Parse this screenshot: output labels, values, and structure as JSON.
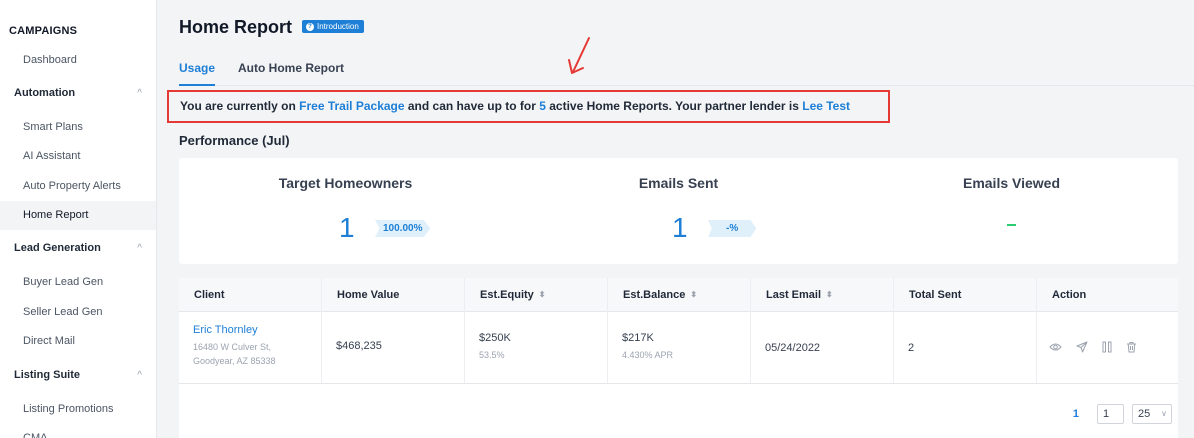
{
  "sidebar": {
    "title": "CAMPAIGNS",
    "dashboard": "Dashboard",
    "automation": "Automation",
    "smart_plans": "Smart Plans",
    "ai_assistant": "AI Assistant",
    "auto_property_alerts": "Auto Property Alerts",
    "home_report": "Home Report",
    "lead_generation": "Lead Generation",
    "buyer_lead_gen": "Buyer Lead Gen",
    "seller_lead_gen": "Seller Lead Gen",
    "direct_mail": "Direct Mail",
    "listing_suite": "Listing Suite",
    "listing_promotions": "Listing Promotions",
    "cma": "CMA",
    "chevron": "^"
  },
  "header": {
    "title": "Home Report",
    "badge": "Introduction",
    "badge_icon": "?"
  },
  "tabs": {
    "usage": "Usage",
    "auto": "Auto Home Report"
  },
  "notice": {
    "part1": "You are currently on ",
    "package": "Free Trail Package",
    "part2": " and can have up to for ",
    "count": "5",
    "part3": " active Home Reports. Your partner lender is ",
    "lender": "Lee Test"
  },
  "performance": {
    "title": "Performance (Jul)",
    "target_label": "Target Homeowners",
    "target_value": "1",
    "target_pct": "100.00%",
    "emails_sent_label": "Emails Sent",
    "emails_sent_value": "1",
    "emails_sent_pct": "-%",
    "emails_viewed_label": "Emails Viewed"
  },
  "table": {
    "headers": {
      "client": "Client",
      "home_value": "Home Value",
      "equity": "Est.Equity",
      "balance": "Est.Balance",
      "last_email": "Last Email",
      "total_sent": "Total Sent",
      "action": "Action"
    },
    "sort_glyph": "⬍",
    "row": {
      "name": "Eric Thornley",
      "addr1": "16480 W Culver St,",
      "addr2": "Goodyear, AZ 85338",
      "home_value": "$468,235",
      "equity": "$250K",
      "equity_pct": "53.5%",
      "balance": "$217K",
      "apr": "4.430% APR",
      "last_email": "05/24/2022",
      "total_sent": "2"
    }
  },
  "pager": {
    "current": "1",
    "input": "1",
    "size": "25",
    "size_chevron": "∨"
  },
  "colors": {
    "accent": "#1d7fd6",
    "highlight_border": "#e53935",
    "success": "#2ecc71"
  }
}
